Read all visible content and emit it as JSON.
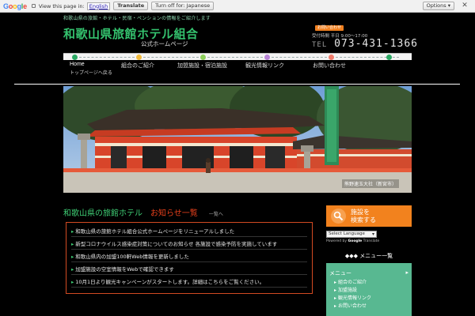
{
  "translate_bar": {
    "logo": [
      "G",
      "o",
      "o",
      "g",
      "l",
      "e"
    ],
    "prompt": "View this page in:",
    "language": "English",
    "translate_btn": "Translate",
    "turn_off_btn": "Turn off for: Japanese",
    "options_btn": "Options ▾",
    "close": "✕"
  },
  "header": {
    "tagline": "和歌山県の旅館・ホテル・民宿・ペンションの情報をご紹介します",
    "title": "和歌山県旅館ホテル組合",
    "subtitle": "公式ホームページ",
    "contact_badge": "お問い合わせ",
    "contact_hours": "受付時間 平日 9:00〜17:00",
    "tel_prefix": "TEL",
    "tel_number": "073-431-1366"
  },
  "nav": {
    "home": "Home",
    "home_sub": "トップページへ戻る",
    "items": [
      "組合のご紹介",
      "加盟施設・宿泊施設",
      "観光情報リンク",
      "お問い合わせ"
    ],
    "dot_colors": [
      "#2aa862",
      "#f0b93a",
      "#8ccf5a",
      "#b884d6",
      "#f07a6a"
    ]
  },
  "hero": {
    "caption": "熊野速玉大社（新宮市）",
    "banner_text": "熊野速玉大社"
  },
  "main": {
    "heading": "和歌山県の旅館ホテル",
    "heading_accent": "お知らせ一覧",
    "heading_tiny": "一覧へ",
    "news": [
      "和歌山県の旅館ホテル組合公式ホームページをリニューアルしました",
      "新型コロナウイルス感染症対策についてのお知らせ 各施設で感染予防を実施しています",
      "和歌山県内の加盟100軒Web情報を更新しました",
      "加盟施設の空室情報をWebで確認できます",
      "10月1日より観光キャンペーンがスタートします。詳細はこちらをご覧ください。"
    ]
  },
  "sidebar": {
    "search_label_1": "施設を",
    "search_label_2": "検索する",
    "lang_select": "Select Language",
    "powered_by": "Powered by",
    "powered_brand": "Google",
    "powered_suffix": "Translate",
    "section_head": "◆◆◆ メニュー一覧",
    "menu_head": "メニュー",
    "menu_arrow": "▸",
    "menu_items": [
      "組合のご紹介",
      "加盟施設",
      "観光情報リンク",
      "お問い合わせ"
    ]
  },
  "colors": {
    "brand_green": "#34c26e",
    "accent_orange": "#f2821e",
    "accent_red": "#e8401c",
    "sidebar_green": "#58b891"
  }
}
